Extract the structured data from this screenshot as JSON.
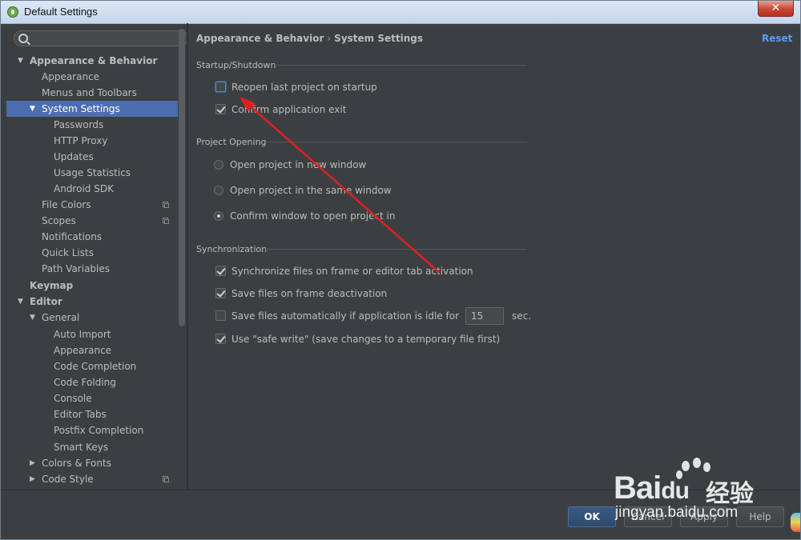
{
  "window": {
    "title": "Default Settings",
    "close_label": "✕"
  },
  "sidebar": {
    "search_placeholder": "",
    "items": [
      {
        "label": "Appearance & Behavior",
        "arrow": "▼"
      },
      {
        "label": "Appearance"
      },
      {
        "label": "Menus and Toolbars"
      },
      {
        "label": "System Settings",
        "arrow": "▼"
      },
      {
        "label": "Passwords"
      },
      {
        "label": "HTTP Proxy"
      },
      {
        "label": "Updates"
      },
      {
        "label": "Usage Statistics"
      },
      {
        "label": "Android SDK"
      },
      {
        "label": "File Colors"
      },
      {
        "label": "Scopes"
      },
      {
        "label": "Notifications"
      },
      {
        "label": "Quick Lists"
      },
      {
        "label": "Path Variables"
      },
      {
        "label": "Keymap"
      },
      {
        "label": "Editor",
        "arrow": "▼"
      },
      {
        "label": "General",
        "arrow": "▼"
      },
      {
        "label": "Auto Import"
      },
      {
        "label": "Appearance"
      },
      {
        "label": "Code Completion"
      },
      {
        "label": "Code Folding"
      },
      {
        "label": "Console"
      },
      {
        "label": "Editor Tabs"
      },
      {
        "label": "Postfix Completion"
      },
      {
        "label": "Smart Keys"
      },
      {
        "label": "Colors & Fonts",
        "arrow": "▶"
      },
      {
        "label": "Code Style",
        "arrow": "▶"
      }
    ]
  },
  "header": {
    "breadcrumb_parent": "Appearance & Behavior",
    "breadcrumb_sep": "›",
    "breadcrumb_current": "System Settings",
    "reset_label": "Reset"
  },
  "startup": {
    "title": "Startup/Shutdown",
    "reopen_label": "Reopen last project on startup",
    "reopen_checked": false,
    "confirm_exit_label": "Confirm application exit",
    "confirm_exit_checked": true
  },
  "project_opening": {
    "title": "Project Opening",
    "options": [
      {
        "label": "Open project in new window",
        "selected": false
      },
      {
        "label": "Open project in the same window",
        "selected": false
      },
      {
        "label": "Confirm window to open project in",
        "selected": true
      }
    ]
  },
  "sync": {
    "title": "Synchronization",
    "items": [
      {
        "label": "Synchronize files on frame or editor tab activation",
        "checked": true
      },
      {
        "label": "Save files on frame deactivation",
        "checked": true
      },
      {
        "label": "Save files automatically if application is idle for",
        "checked": false
      },
      {
        "label": "Use \"safe write\" (save changes to a temporary file first)",
        "checked": true
      }
    ],
    "idle_value": "15",
    "idle_unit": "sec."
  },
  "footer": {
    "ok_label": "OK",
    "cancel_label": "Cancel",
    "apply_label": "Apply",
    "help_label": "Help"
  },
  "watermark": {
    "brand": "Bai",
    "brand_suffix": "du",
    "cn": "经验",
    "url": "jingyan.baidu.com"
  },
  "colors": {
    "selection": "#4b6eaf",
    "link": "#589df6",
    "annotation_arrow": "#e02020"
  }
}
